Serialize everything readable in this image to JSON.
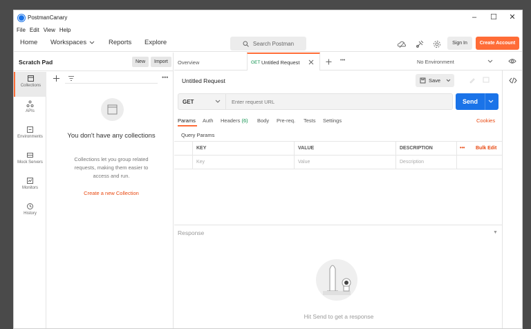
{
  "app": {
    "title": "PostmanCanary"
  },
  "menu": [
    "File",
    "Edit",
    "View",
    "Help"
  ],
  "header": {
    "home": "Home",
    "workspaces": "Workspaces",
    "reports": "Reports",
    "explore": "Explore",
    "search_placeholder": "Search Postman",
    "sign_in": "Sign In",
    "create_account": "Create Account",
    "accent": "#ff6c37"
  },
  "sidebar": {
    "title": "Scratch Pad",
    "new_label": "New",
    "import_label": "Import",
    "nav": [
      {
        "label": "Collections",
        "icon": "collections-icon"
      },
      {
        "label": "APIs",
        "icon": "apis-icon"
      },
      {
        "label": "Environments",
        "icon": "environments-icon"
      },
      {
        "label": "Mock Servers",
        "icon": "mock-servers-icon"
      },
      {
        "label": "Monitors",
        "icon": "monitors-icon"
      },
      {
        "label": "History",
        "icon": "history-icon"
      }
    ],
    "empty_title": "You don't have any collections",
    "empty_desc": "Collections let you group related requests, making them easier to access and run.",
    "empty_link": "Create a new Collection"
  },
  "tabs": {
    "overview": "Overview",
    "active_method": "GET",
    "active_title": "Untitled Request",
    "environment": "No Environment"
  },
  "request": {
    "title": "Untitled Request",
    "save_label": "Save",
    "method": "GET",
    "url_placeholder": "Enter request URL",
    "send_label": "Send",
    "tabs": {
      "params": "Params",
      "auth": "Auth",
      "headers": "Headers",
      "headers_count": "(6)",
      "body": "Body",
      "prereq": "Pre-req.",
      "tests": "Tests",
      "settings": "Settings",
      "cookies": "Cookies"
    },
    "query_params_label": "Query Params",
    "columns": {
      "key": "KEY",
      "value": "VALUE",
      "description": "DESCRIPTION",
      "bulk_edit": "Bulk Edit"
    },
    "placeholders": {
      "key": "Key",
      "value": "Value",
      "description": "Description"
    }
  },
  "response": {
    "label": "Response",
    "hint": "Hit Send to get a response"
  }
}
